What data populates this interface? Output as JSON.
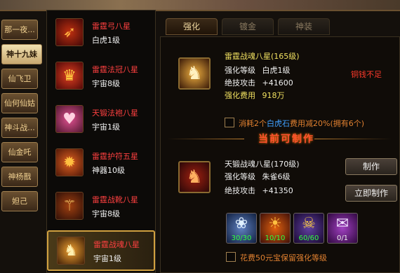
{
  "characters": [
    "那一夜...",
    "神十九妹",
    "仙飞卫",
    "仙何仙姑",
    "神斗战...",
    "仙金吒",
    "神杨戬",
    "妲己"
  ],
  "active_character_index": 1,
  "items": [
    {
      "name": "雷霆弓八星",
      "level": "白虎1级",
      "icon": "bow-icon"
    },
    {
      "name": "雷霆法冠八星",
      "level": "宇宙8级",
      "icon": "crown-icon"
    },
    {
      "name": "天锻法袍八星",
      "level": "宇宙1级",
      "icon": "robe-icon"
    },
    {
      "name": "雷霆护符五星",
      "level": "神器10级",
      "icon": "amulet-icon"
    },
    {
      "name": "雷霆战靴八星",
      "level": "宇宙8级",
      "icon": "boots-icon"
    },
    {
      "name": "雷霆战魂八星",
      "level": "宇宙1级",
      "icon": "warsoul-icon"
    }
  ],
  "selected_item_index": 5,
  "tabs": [
    "强化",
    "镀金",
    "神装"
  ],
  "active_tab_index": 0,
  "upgrade": {
    "item_name": "雷霆战魂八星",
    "item_level": "(165级)",
    "level_label": "强化等级",
    "level_value": "白虎1级",
    "attack_label": "绝技攻击",
    "attack_value": "+41600",
    "cost_label": "强化费用",
    "cost_value": "918万",
    "warning": "铜钱不足",
    "checkbox_text_1": "消耗2个",
    "checkbox_text_2": "白虎石",
    "checkbox_text_3": "费用减20%(拥有6个)"
  },
  "craft": {
    "divider_title": "当前可制作",
    "item_name": "天锻战魂八星",
    "item_level": "(170级)",
    "level_label": "强化等级",
    "level_value": "朱雀6级",
    "attack_label": "绝技攻击",
    "attack_value": "+41350",
    "make_button": "制作",
    "make_now_button": "立即制作",
    "materials": [
      {
        "icon": "lotus-icon",
        "count": "30/30"
      },
      {
        "icon": "pumpkin-icon",
        "count": "10/10"
      },
      {
        "icon": "demon-icon",
        "count": "60/60"
      },
      {
        "icon": "scroll-icon",
        "count": "0/1"
      }
    ],
    "keep_checkbox_text": "花费50元宝保留强化等级"
  }
}
